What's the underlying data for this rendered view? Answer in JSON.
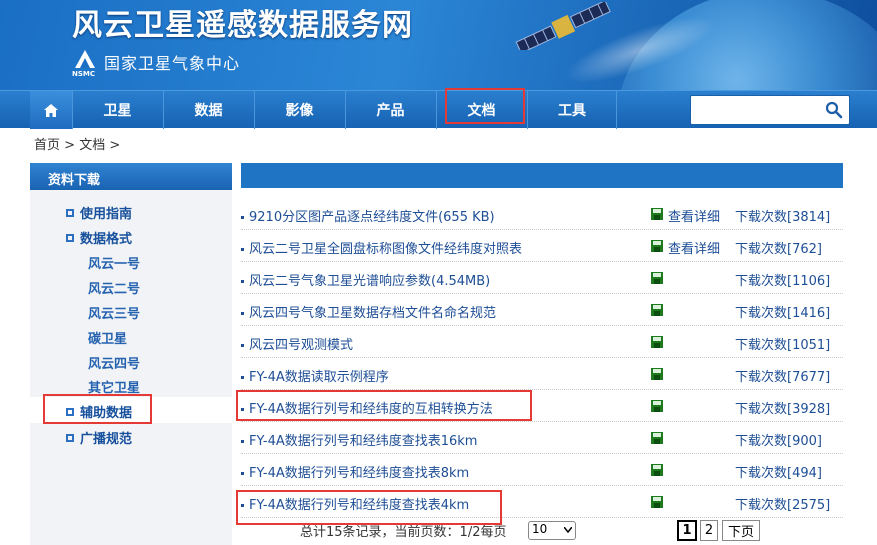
{
  "header": {
    "site_title": "风云卫星遥感数据服务网",
    "org_name": "国家卫星气象中心",
    "logo_label": "NSMC"
  },
  "nav": {
    "items": [
      {
        "label": "卫星"
      },
      {
        "label": "数据"
      },
      {
        "label": "影像"
      },
      {
        "label": "产品"
      },
      {
        "label": "文档"
      },
      {
        "label": "工具"
      }
    ],
    "search": {
      "value": "",
      "placeholder": ""
    }
  },
  "breadcrumb": {
    "home": "首页",
    "sep1": " > ",
    "current": "文档",
    "sep2": " >"
  },
  "sidebar": {
    "title": "资料下载",
    "items": [
      {
        "label": "使用指南"
      },
      {
        "label": "数据格式"
      },
      {
        "label": "辅助数据"
      },
      {
        "label": "广播规范"
      }
    ],
    "sub_items": [
      {
        "label": "风云一号"
      },
      {
        "label": "风云二号"
      },
      {
        "label": "风云三号"
      },
      {
        "label": "碳卫星"
      },
      {
        "label": "风云四号"
      },
      {
        "label": "其它卫星"
      }
    ]
  },
  "documents": [
    {
      "title": "9210分区图产品逐点经纬度文件(655 KB)",
      "detail": "查看详细",
      "downloads": "下载次数[3814]"
    },
    {
      "title": "风云二号卫星全圆盘标称图像文件经纬度对照表",
      "detail": "查看详细",
      "downloads": "下载次数[762]"
    },
    {
      "title": "风云二号气象卫星光谱响应参数(4.54MB)",
      "detail": "",
      "downloads": "下载次数[1106]"
    },
    {
      "title": "风云四号气象卫星数据存档文件名命名规范",
      "detail": "",
      "downloads": "下载次数[1416]"
    },
    {
      "title": "风云四号观测模式",
      "detail": "",
      "downloads": "下载次数[1051]"
    },
    {
      "title": "FY-4A数据读取示例程序",
      "detail": "",
      "downloads": "下载次数[7677]"
    },
    {
      "title": "FY-4A数据行列号和经纬度的互相转换方法",
      "detail": "",
      "downloads": "下载次数[3928]"
    },
    {
      "title": "FY-4A数据行列号和经纬度查找表16km",
      "detail": "",
      "downloads": "下载次数[900]"
    },
    {
      "title": "FY-4A数据行列号和经纬度查找表8km",
      "detail": "",
      "downloads": "下载次数[494]"
    },
    {
      "title": "FY-4A数据行列号和经纬度查找表4km",
      "detail": "",
      "downloads": "下载次数[2575]"
    }
  ],
  "pagination": {
    "summary": "总计15条记录，当前页数：1/2每页",
    "per_page": "10",
    "page1": "1",
    "page2": "2",
    "next": "下页"
  },
  "colors": {
    "primary": "#1f74c4",
    "link": "#1d4e96",
    "highlight": "#e53935"
  }
}
